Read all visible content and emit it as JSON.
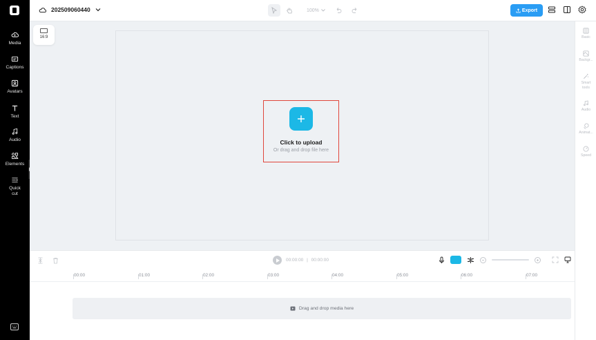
{
  "app": {
    "project_name": "202509060440",
    "zoom_label": "100%",
    "export_label": "Export"
  },
  "sidebar": {
    "items": [
      {
        "label": "Media",
        "icon": "cloud-upload-icon"
      },
      {
        "label": "Captions",
        "icon": "captions-icon"
      },
      {
        "label": "Avatars",
        "icon": "avatar-icon"
      },
      {
        "label": "Text",
        "icon": "text-icon"
      },
      {
        "label": "Audio",
        "icon": "music-note-icon"
      },
      {
        "label": "Elements",
        "icon": "elements-grid-icon"
      },
      {
        "label": "Quick",
        "label2": "cut",
        "icon": "quick-cut-icon"
      }
    ]
  },
  "canvas": {
    "aspect_ratio": "16:9",
    "upload_title": "Click to upload",
    "upload_subtitle": "Or drag and drop file here"
  },
  "right_panel": {
    "items": [
      {
        "label": "Basic",
        "icon": "basic-icon"
      },
      {
        "label": "Backgr...",
        "icon": "background-icon"
      },
      {
        "label": "Smart",
        "label2": "tools",
        "icon": "magic-wand-icon"
      },
      {
        "label": "Audio",
        "icon": "music-note-icon"
      },
      {
        "label": "Animat...",
        "icon": "animation-icon"
      },
      {
        "label": "Speed",
        "icon": "speed-icon"
      }
    ]
  },
  "timeline": {
    "current_time": "00:00:00",
    "separator": "|",
    "total_time": "00:00:00",
    "ruler_ticks": [
      "00:00",
      "01:00",
      "02:00",
      "03:00",
      "04:00",
      "05:00",
      "06:00",
      "07:00"
    ],
    "drop_label": "Drag and drop media here"
  },
  "colors": {
    "accent": "#1cb8e6",
    "export": "#2a9df4",
    "highlight_border": "#e0453a"
  }
}
